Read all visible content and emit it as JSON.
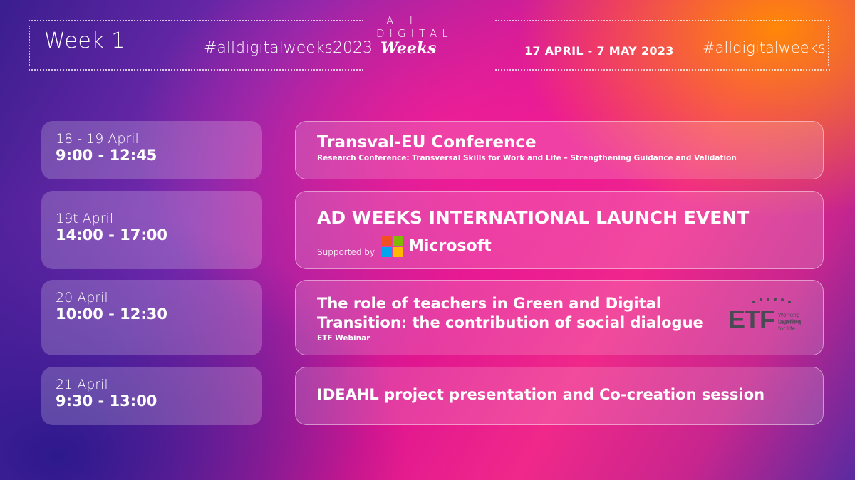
{
  "header": {
    "week": "Week 1",
    "hashtag_year": "#alldigitalweeks2023",
    "logo_line1": "ALL",
    "logo_line2": "DIGITAL",
    "logo_line3": "Weeks",
    "dates": "17 APRIL - 7 MAY 2023",
    "hashtag": "#alldigitalweeks"
  },
  "events": [
    {
      "date": "18 - 19 April",
      "time": "9:00 - 12:45",
      "title": "Transval-EU Conference",
      "subtitle": "Research Conference: Transversal Skills for Work and Life – Strengthening Guidance and Validation"
    },
    {
      "date": "19t April",
      "time": "14:00 - 17:00",
      "title": "AD WEEKS INTERNATIONAL LAUNCH EVENT",
      "supported_by": "Supported by",
      "sponsor": "Microsoft"
    },
    {
      "date": "20 April",
      "time": "10:00 - 12:30",
      "title_line1": "The role of teachers in Green and Digital",
      "title_line2": "Transition: the contribution of social dialogue",
      "subtitle": "ETF Webinar",
      "partner_logo": "ETF",
      "partner_tagline1": "Working together",
      "partner_tagline2": "Learning for life"
    },
    {
      "date": "21 April",
      "time": "9:30 - 13:00",
      "title": "IDEAHL project presentation and Co-creation session"
    }
  ],
  "colors": {
    "ms_red": "#f25022",
    "ms_green": "#7fba00",
    "ms_blue": "#00a4ef",
    "ms_yellow": "#ffb900",
    "etf_grey": "#4a4a55"
  }
}
